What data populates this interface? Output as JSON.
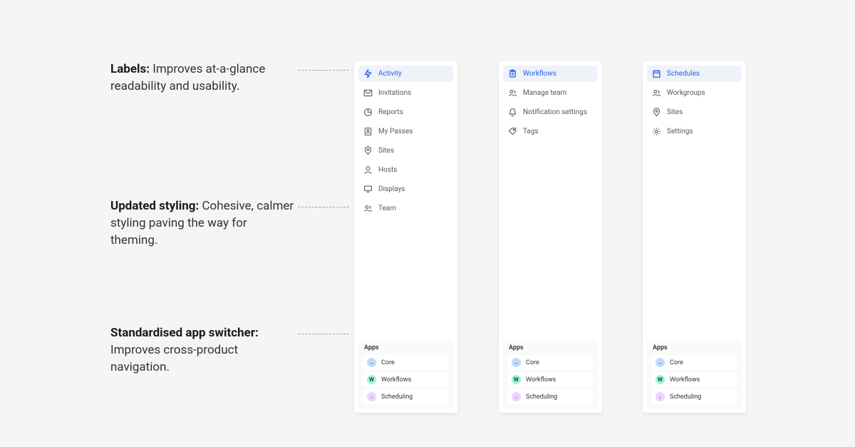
{
  "annotations": {
    "labels_strong": "Labels:",
    "labels_rest": " Improves at-a-glance readability and usability.",
    "styling_strong": "Updated styling:",
    "styling_rest": " Cohesive, calmer styling paving the way for theming.",
    "switcher_strong": "Standardised app switcher:",
    "switcher_rest": " Improves cross-product navigation."
  },
  "panels": [
    {
      "nav": [
        {
          "icon": "zap",
          "label": "Activity",
          "active": true
        },
        {
          "icon": "mail",
          "label": "Invitations"
        },
        {
          "icon": "pie",
          "label": "Reports"
        },
        {
          "icon": "badge",
          "label": "My Passes"
        },
        {
          "icon": "pin",
          "label": "Sites"
        },
        {
          "icon": "user",
          "label": "Hosts"
        },
        {
          "icon": "monitor",
          "label": "Displays"
        },
        {
          "icon": "users",
          "label": "Team"
        }
      ]
    },
    {
      "nav": [
        {
          "icon": "clipboard",
          "label": "Workflows",
          "active": true
        },
        {
          "icon": "users",
          "label": "Manage team"
        },
        {
          "icon": "bell",
          "label": "Notification settings"
        },
        {
          "icon": "tag",
          "label": "Tags"
        }
      ]
    },
    {
      "nav": [
        {
          "icon": "calendar",
          "label": "Schedules",
          "active": true
        },
        {
          "icon": "users",
          "label": "Workgroups"
        },
        {
          "icon": "pin",
          "label": "Sites"
        },
        {
          "icon": "gear",
          "label": "Settings"
        }
      ]
    }
  ],
  "apps": {
    "title": "Apps",
    "items": [
      {
        "key": "core",
        "label": "Core",
        "glyph": "→"
      },
      {
        "key": "workflows",
        "label": "Workflows",
        "glyph": "W"
      },
      {
        "key": "scheduling",
        "label": "Scheduling",
        "glyph": "↓"
      }
    ]
  }
}
